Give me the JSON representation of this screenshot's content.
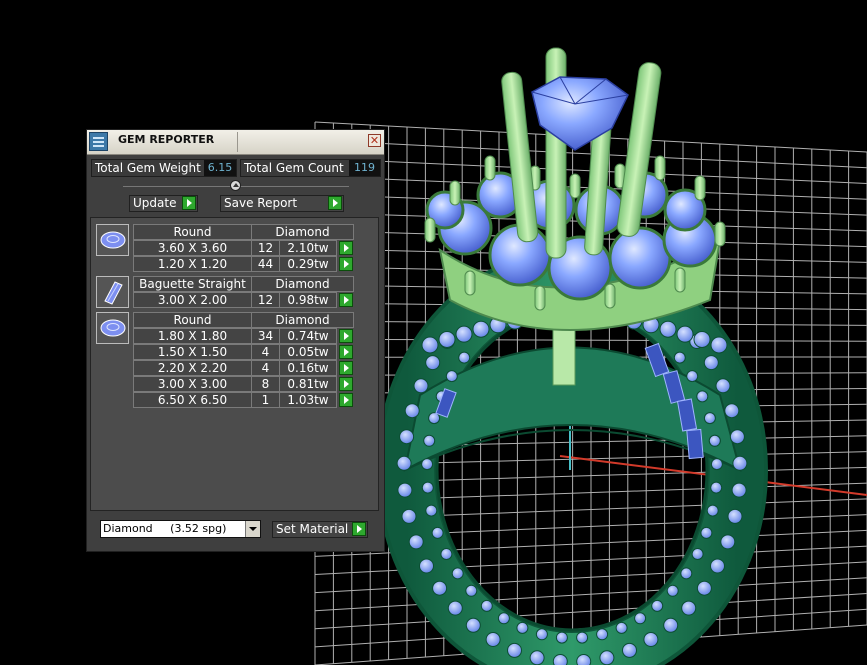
{
  "window": {
    "title": "GEM REPORTER",
    "close_glyph": "✕"
  },
  "summary": {
    "weight_label": "Total Gem Weight",
    "weight_value": "6.15",
    "count_label": "Total Gem Count",
    "count_value": "119"
  },
  "actions": {
    "update_label": "Update",
    "save_label": "Save Report"
  },
  "groups": [
    {
      "shape": "Round",
      "material": "Diamond",
      "icon": "round-gem-icon",
      "rows": [
        {
          "size": "3.60 X 3.60",
          "count": "12",
          "weight": "2.10tw"
        },
        {
          "size": "1.20 X 1.20",
          "count": "44",
          "weight": "0.29tw"
        }
      ]
    },
    {
      "shape": "Baguette Straight",
      "material": "Diamond",
      "icon": "baguette-gem-icon",
      "rows": [
        {
          "size": "3.00 X 2.00",
          "count": "12",
          "weight": "0.98tw"
        }
      ]
    },
    {
      "shape": "Round",
      "material": "Diamond",
      "icon": "round-gem-icon",
      "rows": [
        {
          "size": "1.80 X 1.80",
          "count": "34",
          "weight": "0.74tw"
        },
        {
          "size": "1.50 X 1.50",
          "count": "4",
          "weight": "0.05tw"
        },
        {
          "size": "2.20 X 2.20",
          "count": "4",
          "weight": "0.16tw"
        },
        {
          "size": "3.00 X 3.00",
          "count": "8",
          "weight": "0.81tw"
        },
        {
          "size": "6.50 X 6.50",
          "count": "1",
          "weight": "1.03tw"
        }
      ]
    }
  ],
  "material": {
    "selected": "Diamond     (3.52 spg)",
    "set_label": "Set Material"
  },
  "colors": {
    "viewport_bg": "#000000",
    "grid": "#d0d0d0",
    "ring_body": "#1e7a58",
    "gem_blue": "#7aa0ff",
    "prong_green": "#a8e09a",
    "value_text": "#6fb3d0",
    "arrow_green": "#2ea82e"
  }
}
